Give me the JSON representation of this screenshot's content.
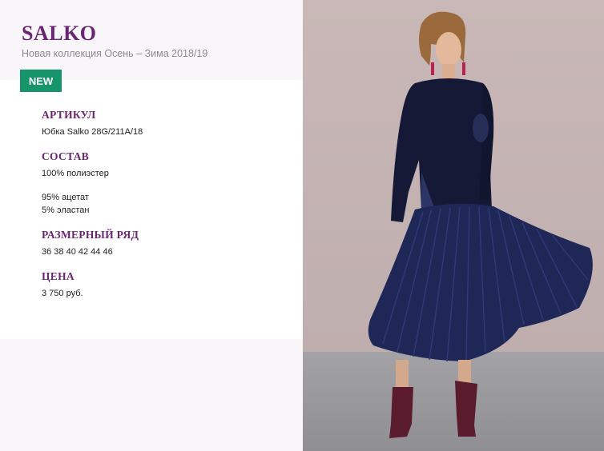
{
  "header": {
    "brand": "SALKO",
    "subtitle": "Новая коллекция Осень – Зима 2018/19",
    "badge": "NEW"
  },
  "specs": {
    "article": {
      "heading": "АРТИКУЛ",
      "value": "Юбка Salko 28G/211A/18"
    },
    "composition": {
      "heading": "СОСТАВ",
      "lines": [
        "100% полиэстер",
        "95% ацетат",
        "5% эластан"
      ]
    },
    "sizes": {
      "heading": "РАЗМЕРНЫЙ РЯД",
      "value": "36 38 40 42 44 46"
    },
    "price": {
      "heading": "ЦЕНА",
      "value": "3 750 руб."
    }
  },
  "colors": {
    "brand": "#6b2472",
    "badge": "#17956a",
    "backdrop": "#c7b6b6",
    "floor": "#9a9a9d",
    "garment": "#1e2452"
  },
  "photo": {
    "subject": "model-in-navy-pleated-skirt"
  }
}
